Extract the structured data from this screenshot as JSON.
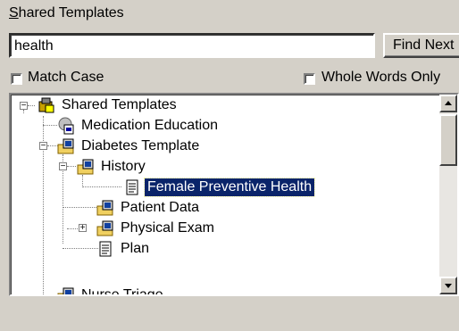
{
  "header": {
    "title_first_letter": "S",
    "title_rest": "hared Templates"
  },
  "search": {
    "value": "health",
    "find_next_label": "Find Next"
  },
  "options": {
    "match_case_label": "Match Case",
    "match_case_checked": false,
    "whole_words_label": "Whole Words Only",
    "whole_words_checked": false
  },
  "tree": {
    "nodes": [
      {
        "label": "Shared Templates",
        "icon": "shared-templates-folder-icon",
        "expander": "minus"
      },
      {
        "label": "Medication Education",
        "icon": "reminder-template-icon",
        "expander": ""
      },
      {
        "label": "Diabetes Template",
        "icon": "folder-template-icon",
        "expander": "minus"
      },
      {
        "label": "History",
        "icon": "folder-template-icon",
        "expander": "minus"
      },
      {
        "label": "Female Preventive Health",
        "icon": "template-document-icon",
        "expander": "",
        "selected": true
      },
      {
        "label": "Patient Data",
        "icon": "folder-template-icon",
        "expander": ""
      },
      {
        "label": "Physical Exam",
        "icon": "folder-template-icon",
        "expander": "plus"
      },
      {
        "label": "Plan",
        "icon": "template-document-icon",
        "expander": ""
      },
      {
        "label": "Nurse Triage",
        "icon": "folder-template-icon",
        "expander": ""
      }
    ]
  },
  "scrollbar": {
    "up_icon": "scroll-up-arrow-icon",
    "down_icon": "scroll-down-arrow-icon"
  }
}
